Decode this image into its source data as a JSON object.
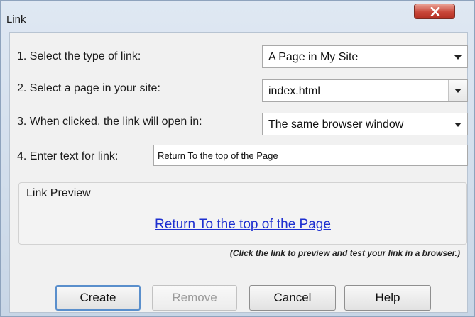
{
  "window": {
    "title": "Link",
    "close_icon": "close-x-icon"
  },
  "form": {
    "type_label": "1. Select the type of link:",
    "type_value": "A Page in My Site",
    "page_label": "2. Select a page in your site:",
    "page_value": "index.html",
    "open_label": "3. When clicked, the link will open in:",
    "open_value": "The same browser window",
    "text_label": "4. Enter text for link:",
    "text_value": "Return To the top of the Page"
  },
  "preview": {
    "title": "Link Preview",
    "link_text": "Return To the top of the Page",
    "link_color": "#1d2fd0",
    "hint": "(Click the link to preview and test your link in a browser.)"
  },
  "buttons": {
    "create": "Create",
    "remove": "Remove",
    "cancel": "Cancel",
    "help": "Help"
  }
}
